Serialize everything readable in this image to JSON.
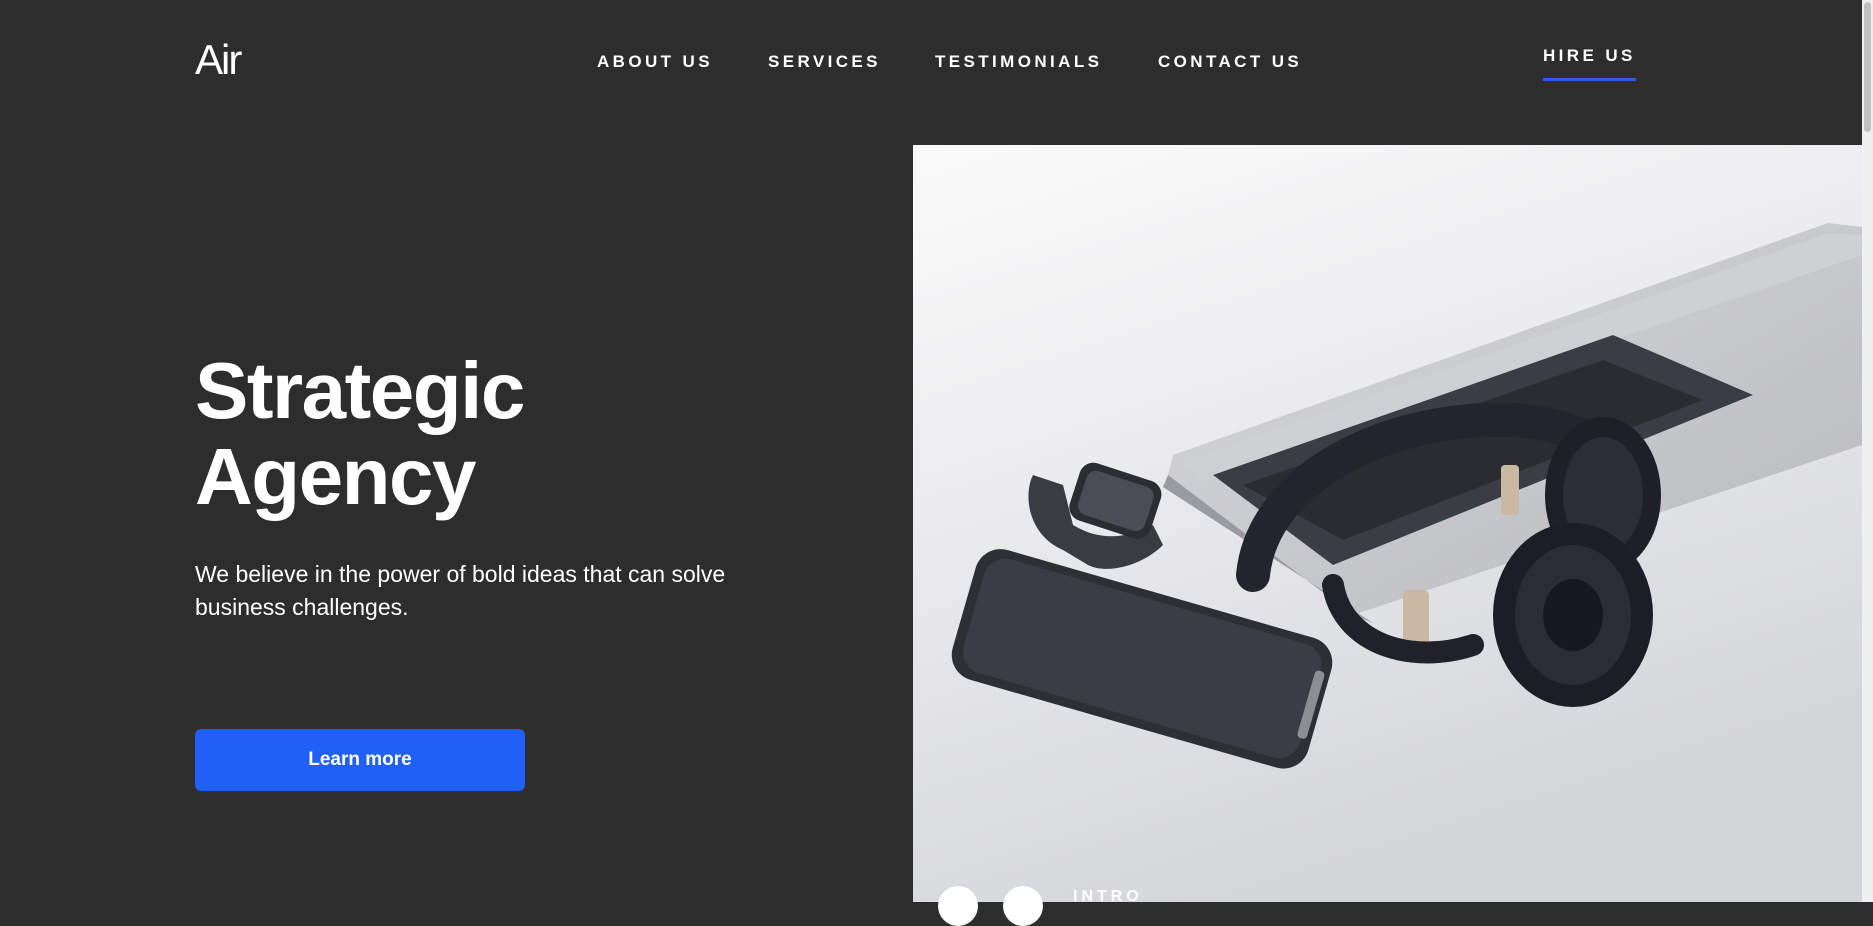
{
  "brand": {
    "logo_text": "Air"
  },
  "nav": {
    "items": [
      {
        "label": "ABOUT US"
      },
      {
        "label": "SERVICES"
      },
      {
        "label": "TESTIMONIALS"
      },
      {
        "label": "CONTACT US"
      }
    ],
    "cta_label": "HIRE US"
  },
  "hero": {
    "title_line1": "Strategic",
    "title_line2": "Agency",
    "subtitle": "We believe in the power of bold ideas that can solve business challenges.",
    "button_label": "Learn more",
    "slide_label": "INTRO"
  },
  "colors": {
    "background": "#2d2d2d",
    "accent": "#2160f6",
    "underline": "#2f5bea"
  }
}
